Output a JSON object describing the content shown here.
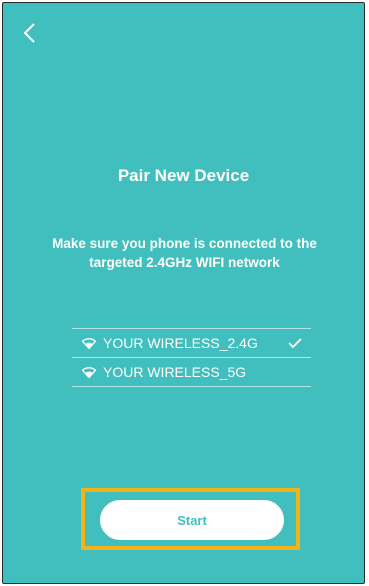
{
  "header": {
    "back_icon": "chevron-left-icon"
  },
  "main": {
    "title": "Pair New Device",
    "instruction": "Make sure you phone is connected to the targeted 2.4GHz WIFI network"
  },
  "wifi_networks": [
    {
      "ssid": "YOUR WIRELESS_2.4G",
      "icon": "wifi-icon",
      "selected": true
    },
    {
      "ssid": "YOUR WIRELESS_5G",
      "icon": "wifi-icon",
      "selected": false
    }
  ],
  "actions": {
    "start_label": "Start"
  },
  "colors": {
    "background": "#41bfbe",
    "highlight": "#f3b31b",
    "text": "#ffffff"
  }
}
